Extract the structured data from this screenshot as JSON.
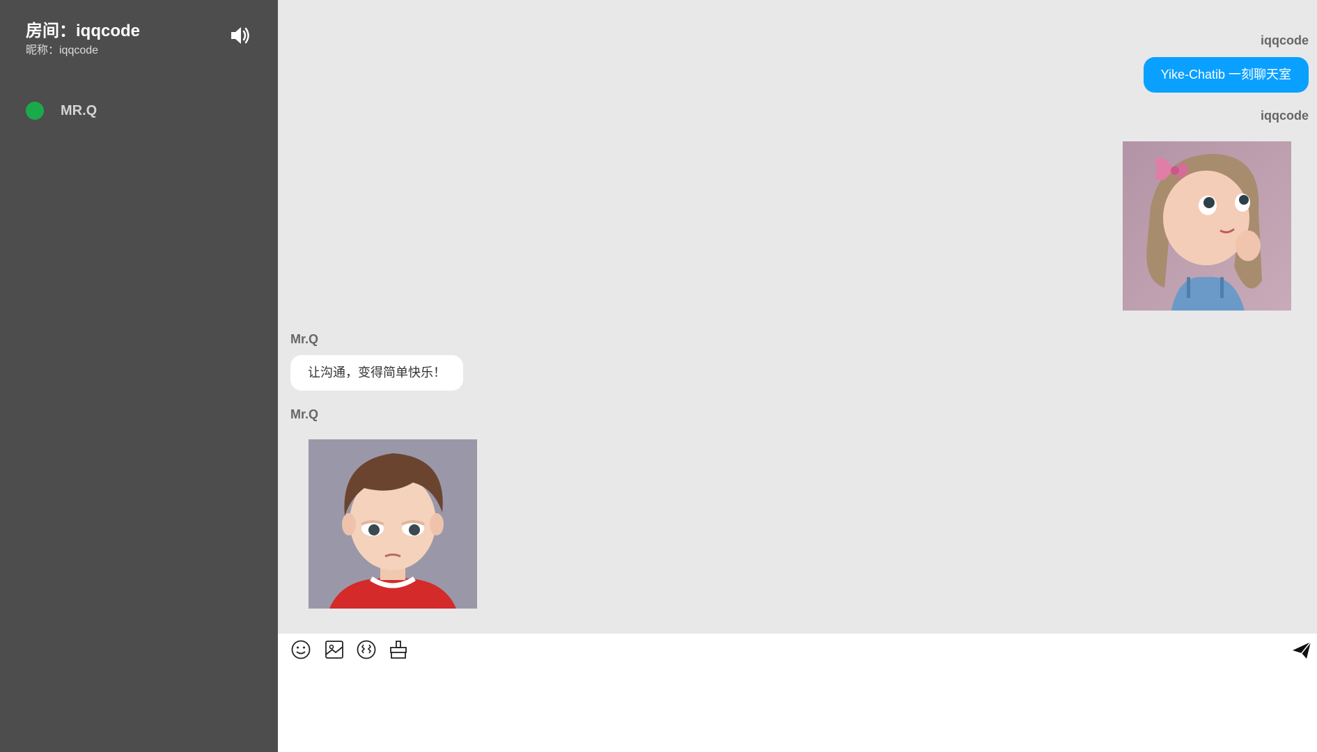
{
  "sidebar": {
    "room_title": "房间：iqqcode",
    "nickname": "昵称：iqqcode",
    "sound_icon": "speaker-volume-icon",
    "users": [
      {
        "name": "MR.Q",
        "status": "online",
        "status_color": "#1aaa4a"
      }
    ]
  },
  "messages": [
    {
      "sender": "iqqcode",
      "direction": "outgoing",
      "type": "text",
      "text": "Yike-Chatib 一刻聊天室"
    },
    {
      "sender": "iqqcode",
      "direction": "outgoing",
      "type": "image",
      "image": "cartoon-girl-portrait"
    },
    {
      "sender": "Mr.Q",
      "direction": "incoming",
      "type": "text",
      "text": "让沟通，变得简单快乐！"
    },
    {
      "sender": "Mr.Q",
      "direction": "incoming",
      "type": "image",
      "image": "cartoon-boy-portrait"
    }
  ],
  "toolbar": {
    "icons": [
      "emoji-icon",
      "image-upload-icon",
      "shake-icon",
      "clear-screen-icon"
    ],
    "send_icon": "send-paper-plane-icon"
  },
  "input": {
    "value": "",
    "placeholder": ""
  },
  "colors": {
    "sidebar_bg": "#4d4d4d",
    "chat_bg": "#e8e8e8",
    "outgoing_bubble": "#0aa0ff",
    "incoming_bubble": "#ffffff",
    "online": "#1aaa4a"
  }
}
